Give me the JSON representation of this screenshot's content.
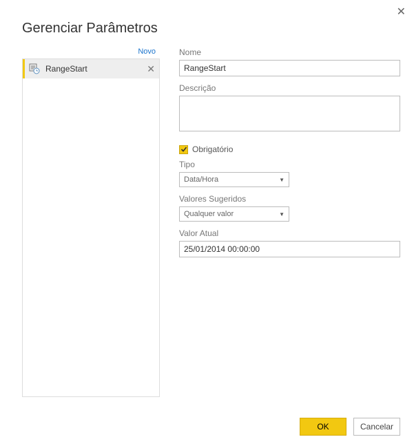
{
  "dialog": {
    "title": "Gerenciar Parâmetros",
    "close_glyph": "✕"
  },
  "sidebar": {
    "new_link": "Novo",
    "items": [
      {
        "label": "RangeStart"
      }
    ],
    "delete_glyph": "✕"
  },
  "form": {
    "name_label": "Nome",
    "name_value": "RangeStart",
    "desc_label": "Descrição",
    "desc_value": "",
    "required_label": "Obrigatório",
    "required_checked": true,
    "type_label": "Tipo",
    "type_value": "Data/Hora",
    "suggested_label": "Valores Sugeridos",
    "suggested_value": "Qualquer valor",
    "current_label": "Valor Atual",
    "current_value": "25/01/2014 00:00:00"
  },
  "footer": {
    "ok": "OK",
    "cancel": "Cancelar"
  }
}
